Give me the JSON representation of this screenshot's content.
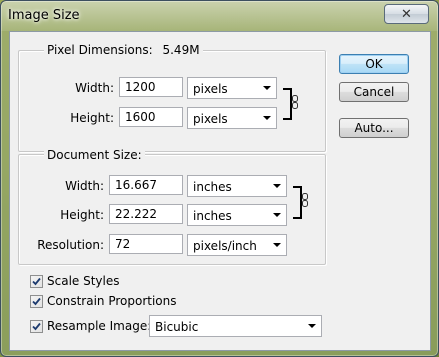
{
  "dialog": {
    "title": "Image Size"
  },
  "pixel_dimensions": {
    "label": "Pixel Dimensions:",
    "size": "5.49M",
    "width_label": "Width:",
    "width_value": "1200",
    "width_unit": "pixels",
    "height_label": "Height:",
    "height_value": "1600",
    "height_unit": "pixels"
  },
  "document_size": {
    "label": "Document Size:",
    "width_label": "Width:",
    "width_value": "16.667",
    "width_unit": "inches",
    "height_label": "Height:",
    "height_value": "22.222",
    "height_unit": "inches",
    "resolution_label": "Resolution:",
    "resolution_value": "72",
    "resolution_unit": "pixels/inch"
  },
  "options": {
    "scale_styles": {
      "label": "Scale Styles",
      "checked": true
    },
    "constrain_proportions": {
      "label": "Constrain Proportions",
      "checked": true
    },
    "resample_image": {
      "label": "Resample Image:",
      "checked": true,
      "method": "Bicubic"
    }
  },
  "buttons": {
    "ok": "OK",
    "cancel": "Cancel",
    "auto": "Auto..."
  }
}
